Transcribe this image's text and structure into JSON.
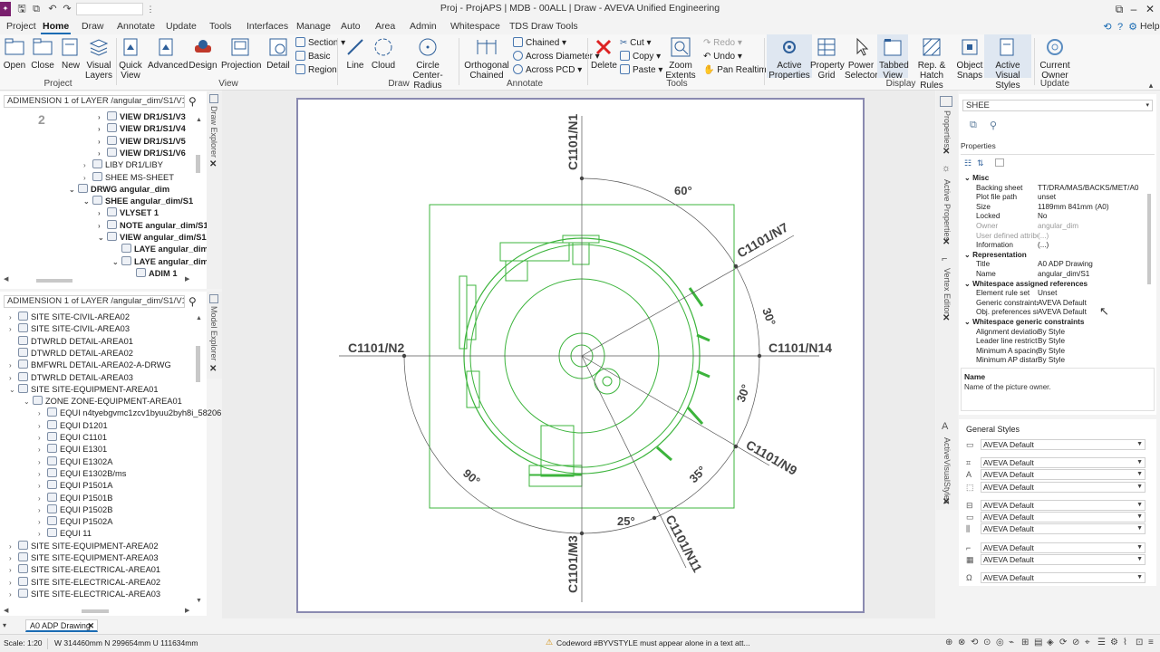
{
  "titlebar": {
    "title": "Proj - ProjAPS | MDB - 00ALL | Draw - AVEVA Unified Engineering",
    "tool_tab": "TDS Draw Tools",
    "help": "Help"
  },
  "menu": {
    "tabs": [
      "Project",
      "Home",
      "Draw",
      "Annotate",
      "Update",
      "Tools",
      "Interfaces",
      "Manage",
      "Auto",
      "Area",
      "Admin",
      "Whitespace"
    ],
    "active": "Home"
  },
  "ribbon": {
    "project": {
      "open": "Open",
      "close": "Close",
      "new": "New",
      "group": "Project"
    },
    "view": {
      "visual_layers": "Visual Layers",
      "quick_view": "Quick View",
      "advanced": "Advanced",
      "design": "Design",
      "projection": "Projection",
      "detail": "Detail",
      "section": "Section",
      "basic": "Basic",
      "region": "Region",
      "group": "View"
    },
    "draw": {
      "line": "Line",
      "cloud": "Cloud",
      "circle_center_radius": "Circle Center-Radius",
      "group": "Draw"
    },
    "annotate": {
      "orthogonal_chained": "Orthogonal Chained",
      "chained": "Chained",
      "across_diameter": "Across Diameter",
      "across_pcd": "Across PCD",
      "group": "Annotate"
    },
    "tools": {
      "delete": "Delete",
      "cut": "Cut",
      "copy": "Copy",
      "paste": "Paste",
      "zoom_extents": "Zoom Extents",
      "redo": "Redo",
      "undo": "Undo",
      "pan_realtime": "Pan Realtime",
      "group": "Tools"
    },
    "display": {
      "active_properties": "Active Properties",
      "property_grid": "Property Grid",
      "power_selector": "Power Selector",
      "tabbed_view": "Tabbed View",
      "rep_hatch_rules": "Rep. & Hatch Rules",
      "object_snaps": "Object Snaps",
      "active_visual_styles": "Active Visual Styles",
      "group": "Display"
    },
    "update": {
      "current_owner": "Current Owner",
      "group": "Update"
    }
  },
  "draw_explorer": {
    "combo": "ADIMENSION 1 of LAYER /angular_dim/S1/V1/USER_D",
    "vtab": "Draw Explorer",
    "page_number": "2",
    "rows": [
      {
        "indent": 5,
        "exp": ">",
        "label": "VIEW DR1/S1/V3",
        "bold": true
      },
      {
        "indent": 5,
        "exp": ">",
        "label": "VIEW DR1/S1/V4",
        "bold": true
      },
      {
        "indent": 5,
        "exp": ">",
        "label": "VIEW DR1/S1/V5",
        "bold": true
      },
      {
        "indent": 5,
        "exp": ">",
        "label": "VIEW DR1/S1/V6",
        "bold": true
      },
      {
        "indent": 4,
        "exp": ">",
        "label": "LIBY DR1/LIBY",
        "bold": false
      },
      {
        "indent": 4,
        "exp": ">",
        "label": "SHEE MS-SHEET",
        "bold": false
      },
      {
        "indent": 3,
        "exp": "v",
        "label": "DRWG angular_dim",
        "bold": true
      },
      {
        "indent": 4,
        "exp": "v",
        "label": "SHEE angular_dim/S1",
        "bold": true
      },
      {
        "indent": 5,
        "exp": ">",
        "label": "VLYSET 1",
        "bold": true
      },
      {
        "indent": 5,
        "exp": ">",
        "label": "NOTE angular_dim/S1/SN1",
        "bold": true
      },
      {
        "indent": 5,
        "exp": "v",
        "label": "VIEW angular_dim/S1/V2",
        "bold": true
      },
      {
        "indent": 6,
        "exp": "",
        "label": "LAYE angular_dim/S1/V",
        "bold": true
      },
      {
        "indent": 6,
        "exp": "v",
        "label": "LAYE angular_dim/S1/V",
        "bold": true
      },
      {
        "indent": 7,
        "exp": "",
        "label": "ADIM 1",
        "bold": true
      }
    ]
  },
  "model_explorer": {
    "combo": "ADIMENSION 1 of LAYER /angular_dim/S1/V1/USER_D",
    "vtab": "Model Explorer",
    "rows": [
      {
        "indent": 0,
        "exp": ">",
        "label": "SITE SITE-CIVIL-AREA02"
      },
      {
        "indent": 0,
        "exp": ">",
        "label": "SITE SITE-CIVIL-AREA03"
      },
      {
        "indent": 0,
        "exp": "",
        "label": "DTWRLD DETAIL-AREA01"
      },
      {
        "indent": 0,
        "exp": "",
        "label": "DTWRLD DETAIL-AREA02"
      },
      {
        "indent": 0,
        "exp": ">",
        "label": "BMFWRL DETAIL-AREA02-A-DRWG"
      },
      {
        "indent": 0,
        "exp": ">",
        "label": "DTWRLD DETAIL-AREA03"
      },
      {
        "indent": 0,
        "exp": "v",
        "label": "SITE SITE-EQUIPMENT-AREA01"
      },
      {
        "indent": 1,
        "exp": "v",
        "label": "ZONE ZONE-EQUIPMENT-AREA01"
      },
      {
        "indent": 2,
        "exp": ">",
        "label": "EQUI n4tyebgvmc1zcv1byuu2byh8i_58206"
      },
      {
        "indent": 2,
        "exp": ">",
        "label": "EQUI D1201"
      },
      {
        "indent": 2,
        "exp": ">",
        "label": "EQUI C1101"
      },
      {
        "indent": 2,
        "exp": ">",
        "label": "EQUI E1301"
      },
      {
        "indent": 2,
        "exp": ">",
        "label": "EQUI E1302A"
      },
      {
        "indent": 2,
        "exp": ">",
        "label": "EQUI E1302B/ms"
      },
      {
        "indent": 2,
        "exp": ">",
        "label": "EQUI P1501A"
      },
      {
        "indent": 2,
        "exp": ">",
        "label": "EQUI P1501B"
      },
      {
        "indent": 2,
        "exp": ">",
        "label": "EQUI P1502B"
      },
      {
        "indent": 2,
        "exp": ">",
        "label": "EQUI P1502A"
      },
      {
        "indent": 2,
        "exp": ">",
        "label": "EQUI 11"
      },
      {
        "indent": 0,
        "exp": ">",
        "label": "SITE SITE-EQUIPMENT-AREA02"
      },
      {
        "indent": 0,
        "exp": ">",
        "label": "SITE SITE-EQUIPMENT-AREA03"
      },
      {
        "indent": 0,
        "exp": ">",
        "label": "SITE SITE-ELECTRICAL-AREA01"
      },
      {
        "indent": 0,
        "exp": ">",
        "label": "SITE SITE-ELECTRICAL-AREA02"
      },
      {
        "indent": 0,
        "exp": ">",
        "label": "SITE SITE-ELECTRICAL-AREA03"
      }
    ]
  },
  "drawing": {
    "labels": {
      "n1": "C1101/N1",
      "n7": "C1101/N7",
      "n2": "C1101/N2",
      "n14": "C1101/N14",
      "n9": "C1101/N9",
      "n3": "C1101/M3",
      "n11": "C1101/N11"
    },
    "angles": {
      "a60": "60°",
      "a30a": "30°",
      "a30b": "30°",
      "a35": "35°",
      "a25": "25°",
      "a90": "90°"
    },
    "line_color": "#3cb43c"
  },
  "properties": {
    "selector": "SHEE",
    "tab_label": "Properties",
    "vtabs": [
      "Properties",
      "Active Properties",
      "Vertex Editor"
    ],
    "sections": {
      "misc": "Misc",
      "representation": "Representation",
      "ws_refs": "Whitespace assigned references",
      "ws_constraints": "Whitespace generic constraints"
    },
    "misc_rows": [
      {
        "k": "Backing sheet",
        "v": "TT/DRA/MAS/BACKS/MET/A0",
        "dim": false
      },
      {
        "k": "Plot file path",
        "v": "unset",
        "dim": false
      },
      {
        "k": "Size",
        "v": "1189mm 841mm (A0)",
        "dim": false
      },
      {
        "k": "Locked",
        "v": "No",
        "dim": false
      },
      {
        "k": "Owner",
        "v": "angular_dim",
        "dim": true
      },
      {
        "k": "User defined attribu",
        "v": "(...)",
        "dim": true
      },
      {
        "k": "Information",
        "v": "(...)",
        "dim": false
      }
    ],
    "rep_rows": [
      {
        "k": "Title",
        "v": "A0 ADP Drawing"
      },
      {
        "k": "Name",
        "v": "angular_dim/S1"
      }
    ],
    "ref_rows": [
      {
        "k": "Element rule set",
        "v": "Unset"
      },
      {
        "k": "Generic constraints",
        "v": "AVEVA Default"
      },
      {
        "k": "Obj. preferences st",
        "v": "AVEVA Default"
      }
    ],
    "con_rows": [
      {
        "k": "Alignment deviation",
        "v": "By Style"
      },
      {
        "k": "Leader line restrict",
        "v": "By Style"
      },
      {
        "k": "Minimum A spacing",
        "v": "By Style"
      },
      {
        "k": "Minimum AP distan",
        "v": "By Style"
      }
    ],
    "desc_title": "Name",
    "desc_text": "Name of the picture owner."
  },
  "styles": {
    "vtab": "ActiveVisualStyles",
    "header": "General Styles",
    "rows": [
      "AVEVA Default",
      "AVEVA Default",
      "AVEVA Default",
      "AVEVA Default",
      "AVEVA Default",
      "AVEVA Default",
      "AVEVA Default",
      "AVEVA Default",
      "AVEVA Default",
      "AVEVA Default"
    ]
  },
  "doc_tab": {
    "label": "A0 ADP Drawing"
  },
  "status": {
    "scale": "Scale: 1:20",
    "coords": "W 314460mm N 299654mm U 111634mm",
    "message": "Codeword #BYVSTYLE must appear alone in a text att..."
  }
}
